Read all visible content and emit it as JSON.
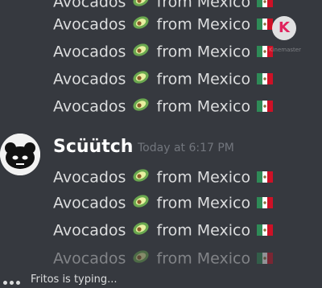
{
  "messages_top": [
    {
      "before": "Avocados",
      "after": "from Mexico"
    },
    {
      "before": "Avocados",
      "after": "from Mexico"
    },
    {
      "before": "Avocados",
      "after": "from Mexico"
    },
    {
      "before": "Avocados",
      "after": "from Mexico"
    },
    {
      "before": "Avocados",
      "after": "from Mexico"
    }
  ],
  "group": {
    "username": "Scüütch",
    "timestamp": "Today at 6:17 PM"
  },
  "messages_bottom": [
    {
      "before": "Avocados",
      "after": "from Mexico"
    },
    {
      "before": "Avocados",
      "after": "from Mexico"
    },
    {
      "before": "Avocados",
      "after": "from Mexico"
    },
    {
      "before": "Avocados",
      "after": "from Mexico"
    }
  ],
  "typing_indicator": "Fritos is typing...",
  "watermark": {
    "letter": "K",
    "sub": "Kinemaster"
  },
  "icons": {
    "avocado": "avocado-emoji-icon",
    "flag": "mexico-flag-emoji-icon"
  },
  "colors": {
    "background": "#36393f",
    "message_text": "#dcddde",
    "username": "#ffffff",
    "timestamp": "#72767d"
  }
}
